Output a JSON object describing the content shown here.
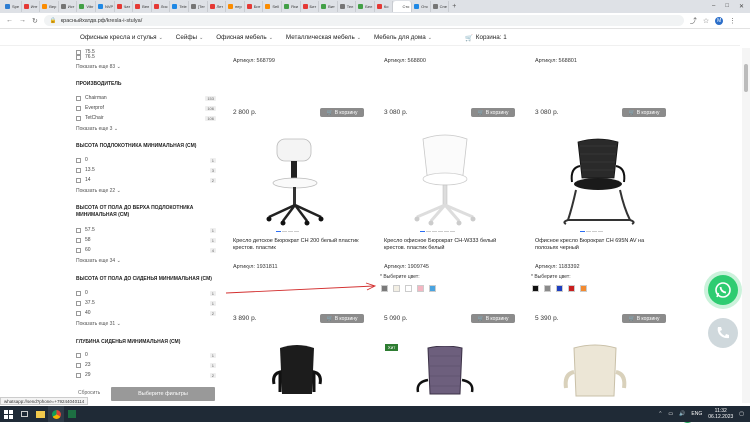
{
  "browser": {
    "tabs": [
      {
        "label": "Spe",
        "color": "#2d7dd2"
      },
      {
        "label": "Инт",
        "color": "#e53935"
      },
      {
        "label": "Вер",
        "color": "#fb8c00"
      },
      {
        "label": "Ист",
        "color": "#757575"
      },
      {
        "label": "Vibr",
        "color": "#43a047"
      },
      {
        "label": "NVP",
        "color": "#1e88e5"
      },
      {
        "label": "Чат",
        "color": "#e53935"
      },
      {
        "label": "Вел",
        "color": "#e53935"
      },
      {
        "label": "Лис",
        "color": "#e53935"
      },
      {
        "label": "Tele",
        "color": "#1e88e5"
      },
      {
        "label": "[Тег",
        "color": "#757575"
      },
      {
        "label": "Лет",
        "color": "#e53935"
      },
      {
        "label": "пер",
        "color": "#fb8c00"
      },
      {
        "label": "Бит",
        "color": "#e53935"
      },
      {
        "label": "Sell",
        "color": "#fb8c00"
      },
      {
        "label": "Яхи",
        "color": "#43a047"
      },
      {
        "label": "Бит",
        "color": "#e53935"
      },
      {
        "label": "Вит",
        "color": "#43a047"
      },
      {
        "label": "Тел",
        "color": "#757575"
      },
      {
        "label": "Бел",
        "color": "#43a047"
      },
      {
        "label": "Ко",
        "color": "#e53935"
      },
      {
        "label": "Сто",
        "color": "#ffffff"
      },
      {
        "label": "Отс",
        "color": "#1e88e5"
      },
      {
        "label": "Спе",
        "color": "#757575"
      }
    ],
    "url": "красныйхатдв.рф/kresla-i-stulya/",
    "avatar_letter": "М"
  },
  "menu": {
    "items": [
      "Офисные кресла и стулья",
      "Сейфы",
      "Офисная мебель",
      "Металлическая мебель",
      "Мебель для дома"
    ],
    "cart": "Корзина: 1"
  },
  "sidebar": {
    "top_items": [
      {
        "label": "75.5",
        "count": ""
      },
      {
        "label": "76.5",
        "count": ""
      }
    ],
    "top_more": "Показать еще 83",
    "manufacturer": {
      "title": "ПРОИЗВОДИТЕЛЬ",
      "items": [
        {
          "label": "Chairman",
          "count": "153"
        },
        {
          "label": "Everprof",
          "count": "106"
        },
        {
          "label": "TetChair",
          "count": "106"
        }
      ],
      "more": "Показать еще 3"
    },
    "armrest_height": {
      "title": "ВЫСОТА ПОДЛОКОТНИКА МИНИМАЛЬНАЯ (СМ)",
      "items": [
        {
          "label": "0",
          "count": "1"
        },
        {
          "label": "13.5",
          "count": "3"
        },
        {
          "label": "14",
          "count": "2"
        }
      ],
      "more": "Показать еще 22"
    },
    "floor_to_armrest": {
      "title": "ВЫСОТА ОТ ПОЛА ДО ВЕРХА ПОДЛОКОТНИКА МИНИМАЛЬНАЯ (СМ)",
      "items": [
        {
          "label": "57.5",
          "count": "1"
        },
        {
          "label": "58",
          "count": "1"
        },
        {
          "label": "60",
          "count": "4"
        }
      ],
      "more": "Показать еще 34"
    },
    "floor_to_seat": {
      "title": "ВЫСОТА ОТ ПОЛА ДО СИДЕНЬЯ МИНИМАЛЬНАЯ (СМ)",
      "items": [
        {
          "label": "0",
          "count": "1"
        },
        {
          "label": "37.5",
          "count": "1"
        },
        {
          "label": "40",
          "count": "2"
        }
      ],
      "more": "Показать еще 31"
    },
    "seat_depth": {
      "title": "ГЛУБИНА СИДЕНЬЯ МИНИМАЛЬНАЯ (СМ)",
      "items": [
        {
          "label": "0",
          "count": "1"
        },
        {
          "label": "23",
          "count": "1"
        },
        {
          "label": "29",
          "count": "2"
        }
      ]
    },
    "reset": "Сбросить",
    "apply": "Выберите фильтры"
  },
  "products_top": [
    {
      "sku": "Артикул: 568799",
      "price": "2 800 р.",
      "buy": "В корзину"
    },
    {
      "sku": "Артикул: 568800",
      "price": "3 080 р.",
      "buy": "В корзину"
    },
    {
      "sku": "Артикул: 568801",
      "price": "3 080 р.",
      "buy": "В корзину"
    }
  ],
  "products_mid": [
    {
      "name": "Кресло детское Бюрократ CH 200 белый пластик крестов. пластик",
      "sku": "Артикул: 1931811",
      "price": "3 890 р.",
      "buy": "В корзину"
    },
    {
      "name": "Кресло офисное Бюрократ CH-W333 белый крестов. пластик белый",
      "sku": "Артикул: 1909745",
      "price": "5 090 р.",
      "buy": "В корзину",
      "color_label": "* Выберите цвет:",
      "swatches": [
        "#7a7a7a",
        "#f3efe4",
        "#ffffff",
        "#f4b6c2",
        "#4aa3df"
      ]
    },
    {
      "name": "Офисное кресло Бюрократ CH 695N AV на полозьях черный",
      "sku": "Артикул: 1183392",
      "price": "5 390 р.",
      "buy": "В корзину",
      "color_label": "* Выберите цвет:",
      "swatches": [
        "#111111",
        "#8a8a8a",
        "#1e3fbf",
        "#c81e1e",
        "#f28a30"
      ]
    }
  ],
  "hit_badge": "Хит",
  "status_bar": "whatsapp://send?phone=+79244040114",
  "taskbar": {
    "lang": "ENG",
    "time": "11:32",
    "date": "06.12.2023"
  },
  "colors": {
    "buy_button": "#8b8b8b",
    "whatsapp": "#2ecc71",
    "slider_active": "#2a6df4"
  }
}
